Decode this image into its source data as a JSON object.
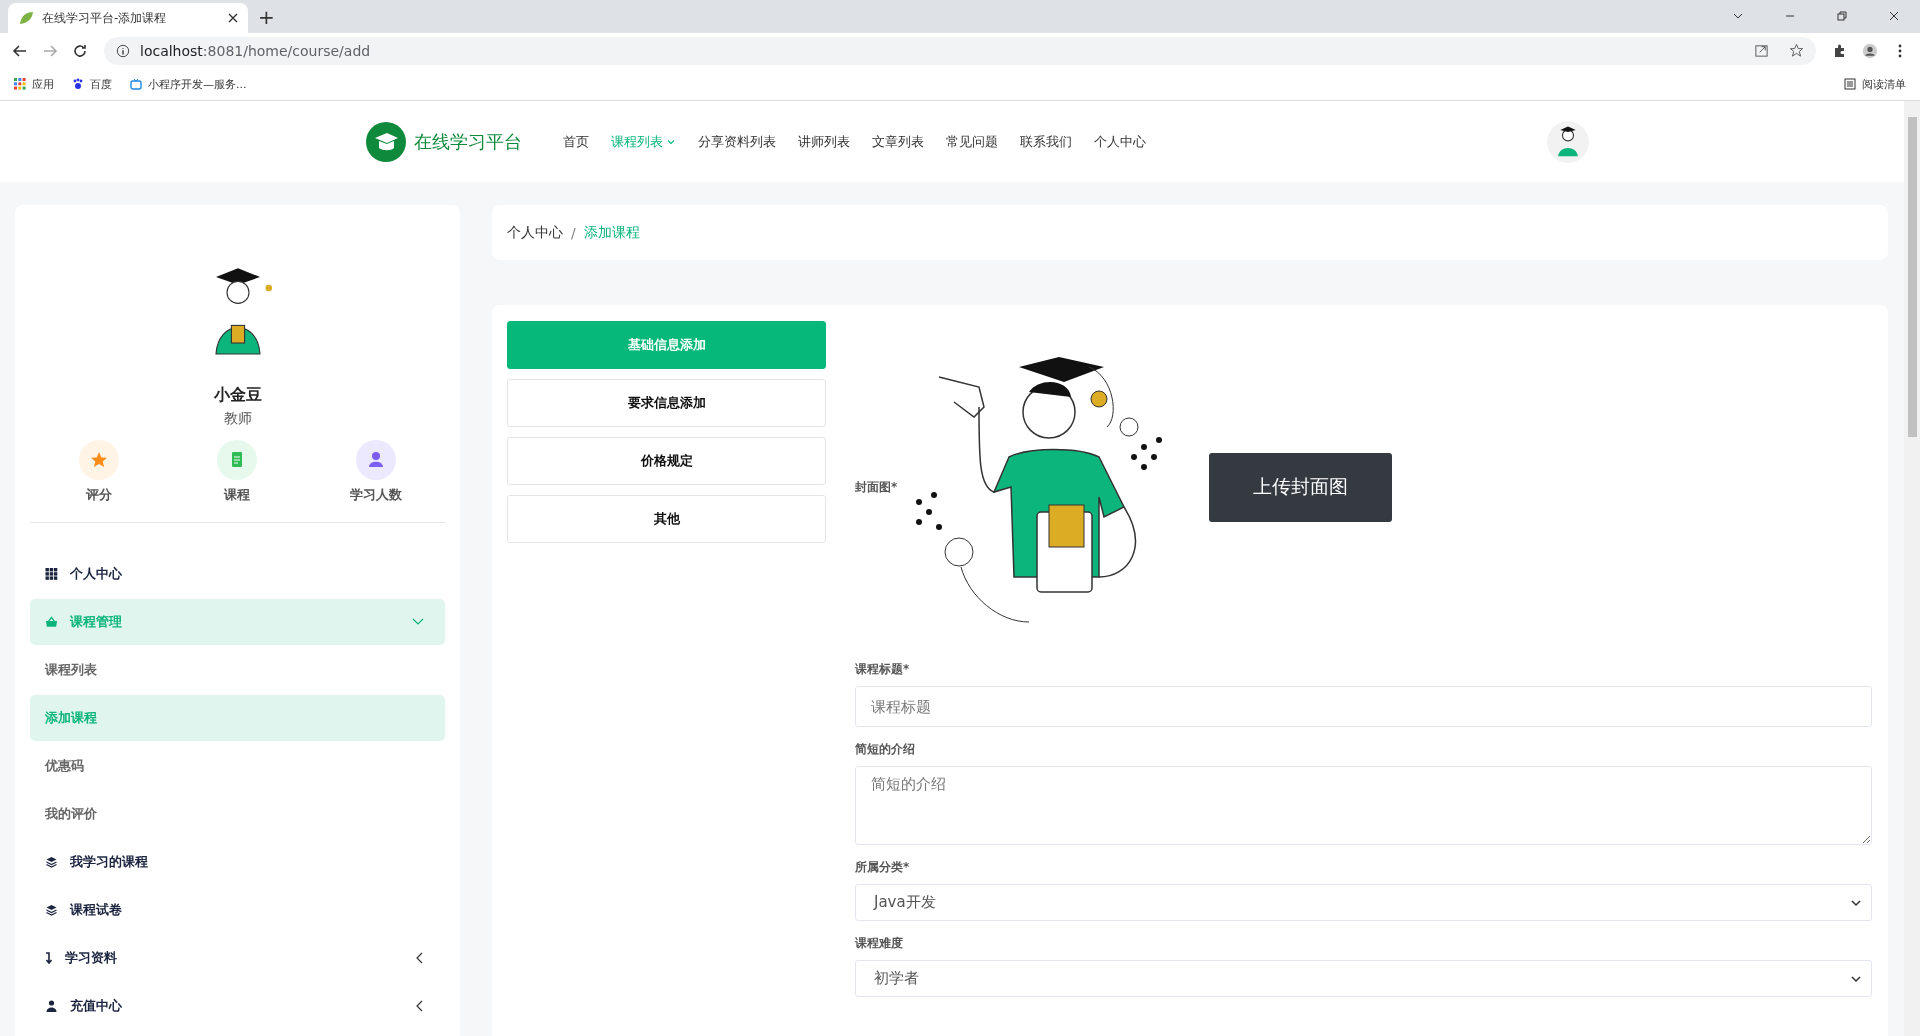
{
  "browser": {
    "tab_title": "在线学习平台-添加课程",
    "new_tab": "+",
    "url_host": "localhost",
    "url_path": ":8081/home/course/add",
    "bookmarks": [
      "应用",
      "百度",
      "小程序开发—服务..."
    ],
    "reading_list": "阅读清单"
  },
  "header": {
    "brand": "在线学习平台",
    "nav": [
      {
        "label": "首页",
        "selected": false,
        "has_menu": false
      },
      {
        "label": "课程列表",
        "selected": true,
        "has_menu": true
      },
      {
        "label": "分享资料列表",
        "selected": false,
        "has_menu": false
      },
      {
        "label": "讲师列表",
        "selected": false,
        "has_menu": false
      },
      {
        "label": "文章列表",
        "selected": false,
        "has_menu": false
      },
      {
        "label": "常见问题",
        "selected": false,
        "has_menu": false
      },
      {
        "label": "联系我们",
        "selected": false,
        "has_menu": false
      },
      {
        "label": "个人中心",
        "selected": false,
        "has_menu": false
      }
    ]
  },
  "profile": {
    "name": "小金豆",
    "role": "教师",
    "stats": [
      "评分",
      "课程",
      "学习人数"
    ]
  },
  "menu": [
    {
      "label": "个人中心",
      "selected": false
    },
    {
      "label": "课程管理",
      "selected": true,
      "expanded": true,
      "children": [
        {
          "label": "课程列表",
          "selected": false
        },
        {
          "label": "添加课程",
          "selected": true
        },
        {
          "label": "优惠码",
          "selected": false
        },
        {
          "label": "我的评价",
          "selected": false
        }
      ]
    },
    {
      "label": "我学习的课程",
      "selected": false
    },
    {
      "label": "课程试卷",
      "selected": false
    },
    {
      "label": "学习资料",
      "selected": false,
      "expanded": false
    },
    {
      "label": "充值中心",
      "selected": false,
      "expanded": false
    }
  ],
  "breadcrumb_separator": "/",
  "breadcrumb": [
    {
      "label": "个人中心",
      "selected": false
    },
    {
      "label": "添加课程",
      "selected": true
    }
  ],
  "steps": [
    {
      "label": "基础信息添加",
      "selected": true
    },
    {
      "label": "要求信息添加",
      "selected": false
    },
    {
      "label": "价格规定",
      "selected": false
    },
    {
      "label": "其他",
      "selected": false
    }
  ],
  "cover": {
    "label": "封面图*",
    "button": "上传封面图"
  },
  "fields": [
    {
      "kind": "input",
      "label": "课程标题*",
      "placeholder": "课程标题"
    },
    {
      "kind": "textarea",
      "label": "简短的介绍",
      "placeholder": "简短的介绍"
    },
    {
      "kind": "select",
      "label": "所属分类*",
      "value": "Java开发"
    },
    {
      "kind": "select",
      "label": "课程难度",
      "value": "初学者"
    }
  ]
}
